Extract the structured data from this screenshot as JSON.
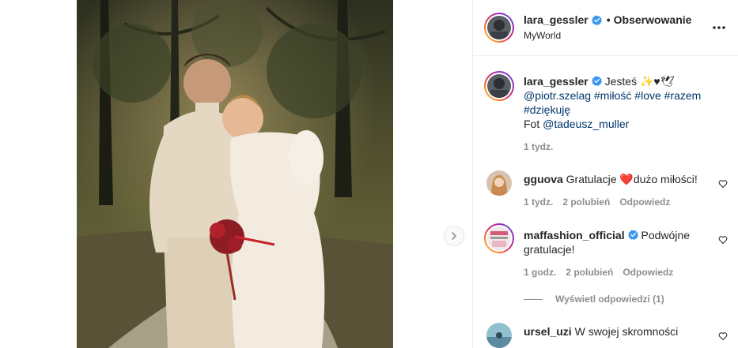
{
  "post": {
    "author": "lara_gessler",
    "follow_label": "Obserwowanie",
    "separator": "•",
    "location": "MyWorld",
    "caption": {
      "username": "lara_gessler",
      "text_start": "Jesteś ✨♥🕊",
      "mention_1": "@piotr.szelag",
      "hashtags": [
        "#miłość",
        "#love",
        "#razem",
        "#dziękuję"
      ],
      "photo_prefix": "Fot",
      "mention_2": "@tadeusz_muller",
      "time": "1 tydz."
    }
  },
  "comments": [
    {
      "username": "gguova",
      "text_before": "Gratulacje",
      "emoji": "❤️",
      "text_after": "dużo miłości!",
      "time": "1 tydz.",
      "likes": "2 polubień",
      "reply": "Odpowiedz"
    },
    {
      "username": "maffashion_official",
      "text": "Podwójne gratulacje!",
      "time": "1 godz.",
      "likes": "2 polubień",
      "reply": "Odpowiedz"
    },
    {
      "username": "ursel_uzi",
      "text": "W swojej skromności"
    }
  ],
  "view_replies": "Wyświetl odpowiedzi (1)",
  "colors": {
    "link": "#00376b",
    "verified": "#3897f0",
    "meta": "#8e8e8e",
    "text": "#262626",
    "border": "#efefef"
  },
  "icons": [
    "chevron-right-icon",
    "verified-badge-icon",
    "more-options-icon",
    "heart-outline-icon"
  ]
}
